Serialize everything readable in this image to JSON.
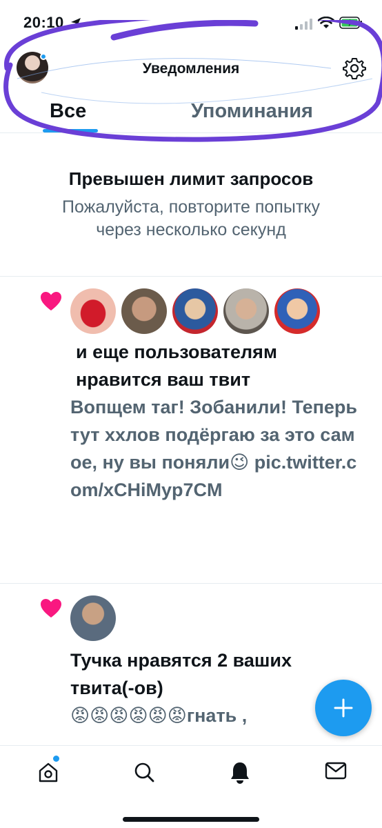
{
  "status_bar": {
    "time": "20:10",
    "icons": [
      "location-arrow-icon",
      "signal-icon",
      "wifi-icon",
      "battery-charging-icon"
    ]
  },
  "header": {
    "title": "Уведомления",
    "settings_icon": "gear-icon"
  },
  "tabs": [
    {
      "label": "Все",
      "active": true
    },
    {
      "label": "Упоминания",
      "active": false
    }
  ],
  "banner": {
    "title": "Превышен лимит запросов",
    "subtitle_line1": "Пожалуйста, повторите попытку",
    "subtitle_line2": "через несколько секунд"
  },
  "notifications": [
    {
      "type": "like",
      "icon": "heart-icon",
      "headline": "и еще пользователям нравится ваш твит",
      "tweet": "Вопщем таг! Зобанили! Теперь тут ххлов подёргаю за это самое, ну вы поняли😉 pic.twitter.com/xCHiMyp7CM"
    },
    {
      "type": "like",
      "icon": "heart-icon",
      "headline": "Тучка нравятся 2 ваших твита(-ов)",
      "tweet": "😡😡😡😡😡😡гнать ,"
    }
  ],
  "fab": {
    "icon": "plus-icon"
  },
  "bottom_nav": {
    "items": [
      "home-icon",
      "search-icon",
      "bell-icon",
      "mail-icon"
    ],
    "active": "bell-icon"
  },
  "colors": {
    "accent": "#1d9bf0",
    "heart": "#f91880",
    "text_primary": "#0f1419",
    "text_secondary": "#536471",
    "scribble": "#6a3fd6"
  }
}
